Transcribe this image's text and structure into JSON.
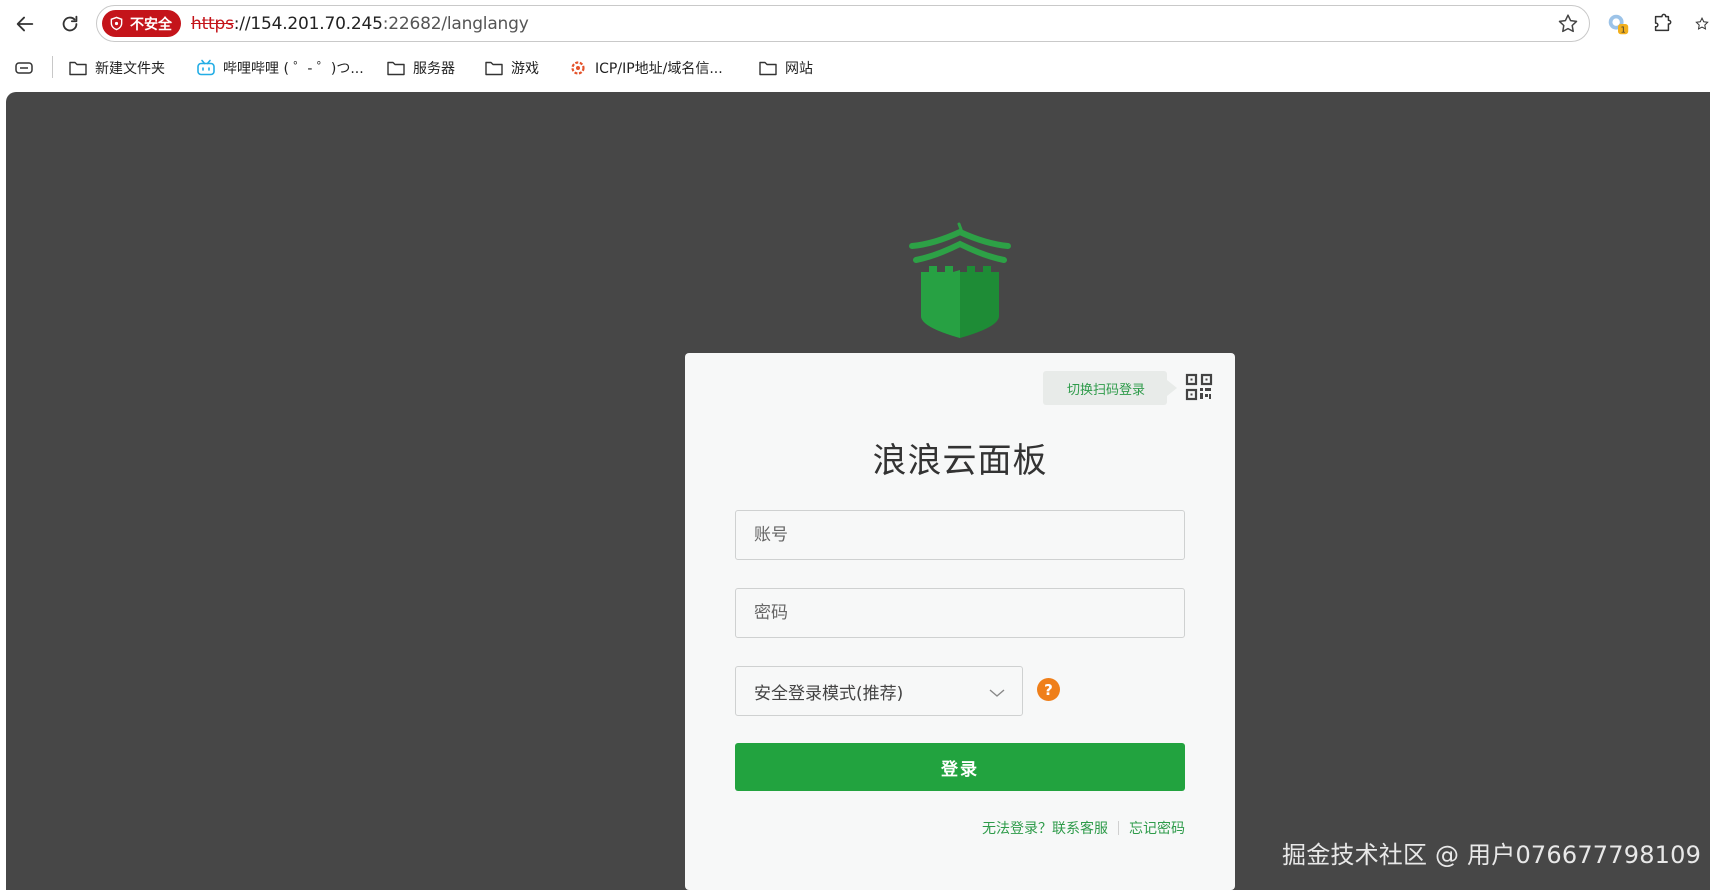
{
  "browser": {
    "security_label": "不安全",
    "url_scheme": "https",
    "url_host": "://154.201.70.245",
    "url_port_path": ":22682/langlangy",
    "bookmarks": [
      {
        "label": "新建文件夹",
        "icon": "folder-icon"
      },
      {
        "label": "哔哩哔哩 ( ゜- ゜)つ...",
        "icon": "bilibili-icon"
      },
      {
        "label": "服务器",
        "icon": "folder-icon"
      },
      {
        "label": "游戏",
        "icon": "folder-icon"
      },
      {
        "label": "ICP/IP地址/域名信...",
        "icon": "site-icon"
      },
      {
        "label": "网站",
        "icon": "folder-icon"
      }
    ]
  },
  "login": {
    "qr_switch_label": "切换扫码登录",
    "title": "浪浪云面板",
    "username_placeholder": "账号",
    "password_placeholder": "密码",
    "mode_selected": "安全登录模式(推荐)",
    "help_symbol": "?",
    "submit_label": "登录",
    "cannot_login_link": "无法登录？联系客服",
    "forgot_password_link": "忘记密码"
  },
  "watermark": "掘金技术社区 @ 用户076677798109",
  "colors": {
    "brand_green": "#22a33f",
    "link_green": "#2e9b4a",
    "help_orange": "#ef7f1a",
    "insecure_red": "#c4141a",
    "page_background": "#474747"
  }
}
